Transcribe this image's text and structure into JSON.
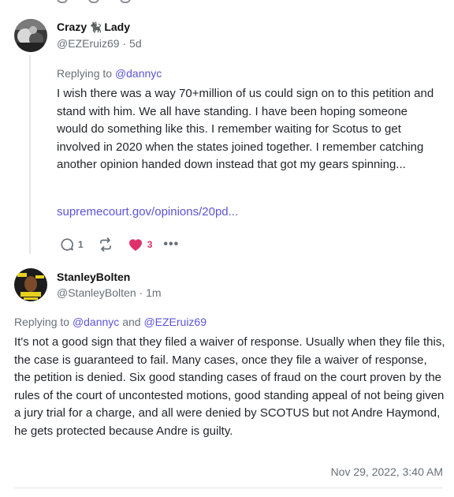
{
  "post1": {
    "display_name_part1": "Crazy",
    "display_name_emoji": "🐈‍⬛",
    "display_name_part2": "Lady",
    "handle": "@EZEruiz69",
    "separator": "·",
    "age": "5d",
    "replying_prefix": "Replying to",
    "replying_to": "@dannyc",
    "text": "I wish there was a way 70+million of us could sign on to this petition and stand with him. We all have standing. I have been hoping someone would do something like this. I remember waiting for Scotus to get involved in 2020 when the states joined together. I remember catching another opinion handed down instead that got my gears spinning...",
    "link": "supremecourt.gov/opinions/20pd...",
    "reply_count": "1",
    "like_count": "3",
    "more_label": "•••"
  },
  "post2": {
    "display_name": "StanleyBolten",
    "handle": "@StanleyBolten",
    "separator": "·",
    "age": "1m",
    "replying_prefix": "Replying to",
    "replying_to_1": "@dannyc",
    "replying_and": "and",
    "replying_to_2": "@EZEruiz69",
    "text": "It's not a good sign that they filed a waiver of response. Usually when they file this, the case is guaranteed to fail. Many cases, once they file a waiver of response, the petition is denied. Six good standing cases of fraud on the court proven by the rules of the court of uncontested motions, good standing appeal of not being given a jury trial for a charge, and all were denied by SCOTUS but not Andre Haymond, he gets protected because Andre is guilty.",
    "timestamp": "Nov 29, 2022, 3:40 AM"
  },
  "colors": {
    "accent": "#5b54d6",
    "like": "#e0306b",
    "muted": "#687078"
  },
  "icons": {
    "reply": "reply-icon",
    "repost": "repost-icon",
    "like": "heart-icon",
    "more": "more-icon"
  }
}
